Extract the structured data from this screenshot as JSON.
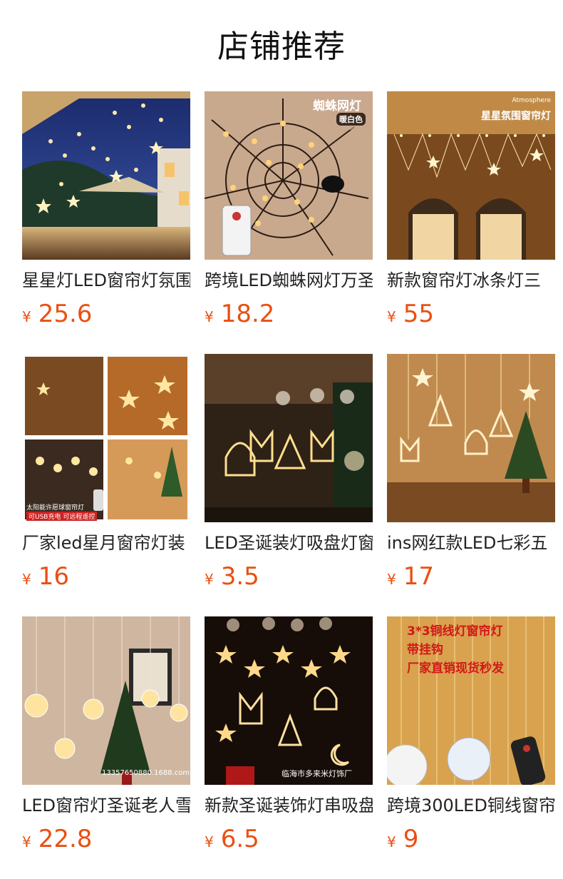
{
  "page": {
    "title": "店铺推荐"
  },
  "currency_symbol": "¥",
  "products": [
    {
      "name": "星星灯LED窗帘灯氛围",
      "price": "25.6",
      "image": "star-curtain-lights-terrace"
    },
    {
      "name": "跨境LED蜘蛛网灯万圣",
      "price": "18.2",
      "image": "spider-web-lights",
      "overlay_lines": [
        "蜘蛛网灯",
        "暖白色"
      ]
    },
    {
      "name": "新款窗帘灯冰条灯三",
      "price": "55",
      "image": "icicle-curtain-lights",
      "overlay_lines": [
        "Atmosphere",
        "星星氛围窗帘灯"
      ]
    },
    {
      "name": "厂家led星月窗帘灯装",
      "price": "16",
      "image": "star-moon-curtain-lights-collage",
      "overlay_lines": [
        "太阳能许愿球窗帘灯",
        "可USB充电 可远程遥控"
      ]
    },
    {
      "name": "LED圣诞装灯吸盘灯窗",
      "price": "3.5",
      "image": "christmas-suction-cup-lights"
    },
    {
      "name": "ins网红款LED七彩五",
      "price": "17",
      "image": "christmas-curtain-lights-tree"
    },
    {
      "name": "LED窗帘灯圣诞老人雪",
      "price": "22.8",
      "image": "wishing-ball-curtain-lights",
      "overlay_lines": [
        "13357650880.1688.com"
      ]
    },
    {
      "name": "新款圣诞装饰灯串吸盘",
      "price": "6.5",
      "image": "christmas-suction-cup-light-strings",
      "overlay_lines": [
        "临海市多来米灯饰厂"
      ]
    },
    {
      "name": "跨境300LED铜线窗帘",
      "price": "9",
      "image": "copper-wire-curtain-lights",
      "overlay_lines": [
        "3*3铜线灯窗帘灯",
        "带挂钩",
        "厂家直销现货秒发"
      ]
    }
  ]
}
